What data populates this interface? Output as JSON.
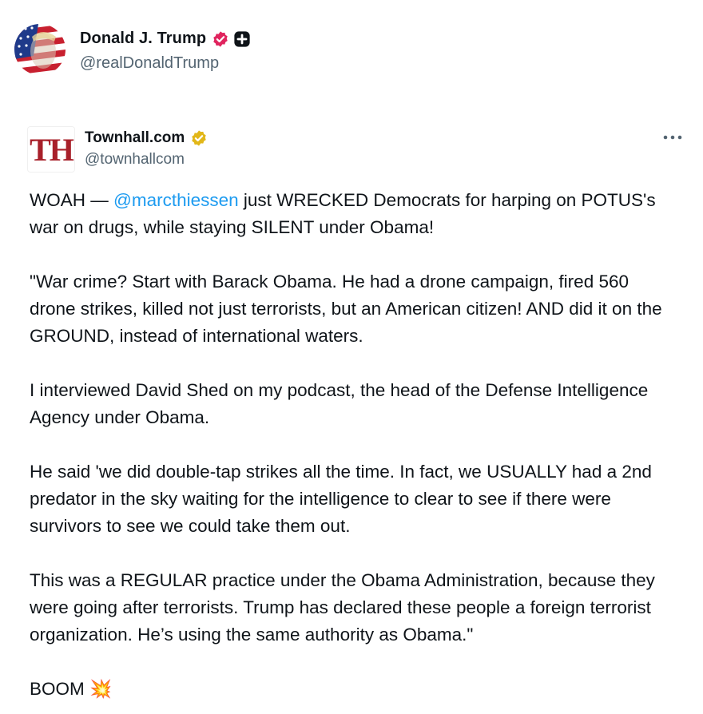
{
  "outer_post": {
    "author_name": "Donald J. Trump",
    "author_handle": "@realDonaldTrump",
    "verified_icon": "verified-badge-icon",
    "affiliate_icon": "plus-badge-icon"
  },
  "quoted_post": {
    "logo_text": "TH",
    "author_name": "Townhall.com",
    "author_handle": "@townhallcom",
    "verified_icon": "gold-verified-badge-icon",
    "more_icon": "more-options-icon",
    "body": {
      "p1_prefix": "WOAH — ",
      "p1_mention": "@marcthiessen",
      "p1_suffix": " just WRECKED Democrats for harping on POTUS's war on drugs, while staying SILENT under Obama!",
      "p2": "\"War crime? Start with Barack Obama. He had a drone campaign, fired 560 drone strikes, killed not just terrorists, but an American citizen! AND did it on the GROUND, instead of international waters.",
      "p3": "I interviewed David Shed on my podcast, the head of the Defense Intelligence Agency under Obama.",
      "p4": "He said 'we did double-tap strikes all the time. In fact, we USUALLY had a 2nd predator in the sky waiting for the intelligence to clear to see if there were survivors to see we could take them out.",
      "p5": "This was a REGULAR practice under the Obama Administration, because they were going after terrorists. Trump has declared these people a foreign terrorist organization. He’s using the same authority as Obama.\"",
      "p6_text": "BOOM ",
      "p6_emoji": "💥"
    }
  },
  "colors": {
    "mention": "#1d9bf0",
    "handle": "#536471",
    "verified_pink": "#e0245e",
    "verified_gold": "#e2b719",
    "logo_red": "#a8202a"
  }
}
